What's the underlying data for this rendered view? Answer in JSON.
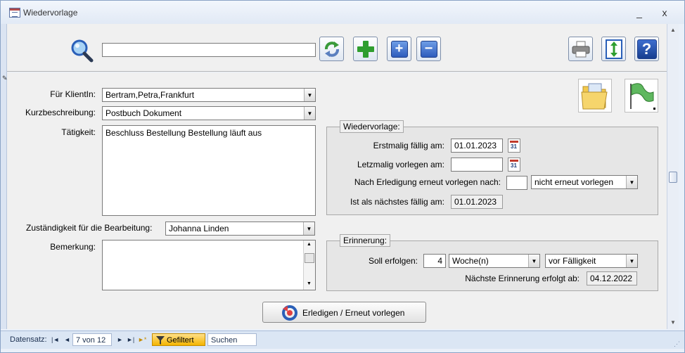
{
  "window": {
    "title": "Wiedervorlage",
    "minimize_glyph": "_",
    "close_glyph": "x"
  },
  "toolbar": {
    "search_value": "",
    "icons": [
      "search-icon",
      "refresh-icon",
      "add-icon",
      "expand-icon",
      "collapse-icon",
      "print-icon",
      "fit-height-icon",
      "help-icon"
    ],
    "expand_glyph": "+",
    "collapse_glyph": "−",
    "help_glyph": "?"
  },
  "form": {
    "klient_label": "Für KlientIn:",
    "klient_value": "Bertram,Petra,Frankfurt",
    "kurz_label": "Kurzbeschreibung:",
    "kurz_value": "Postbuch Dokument",
    "taetigkeit_label": "Tätigkeit:",
    "taetigkeit_value": "Beschluss Bestellung Bestellung läuft aus",
    "zustaendig_label": "Zuständigkeit für die Bearbeitung:",
    "zustaendig_value": "Johanna Linden",
    "bemerkung_label": "Bemerkung:",
    "bemerkung_value": ""
  },
  "wiedervorlage": {
    "legend": "Wiedervorlage:",
    "erstmalig_label": "Erstmalig fällig am:",
    "erstmalig_value": "01.01.2023",
    "letztmalig_label": "Letzmalig vorlegen am:",
    "letztmalig_value": "",
    "nach_label": "Nach Erledigung erneut vorlegen nach:",
    "nach_number": "",
    "nach_option": "nicht erneut vorlegen",
    "naechstes_label": "Ist als nächstes fällig am:",
    "naechstes_value": "01.01.2023",
    "calendar_day": "31"
  },
  "erinnerung": {
    "legend": "Erinnerung:",
    "soll_label": "Soll erfolgen:",
    "soll_number": "4",
    "soll_unit": "Woche(n)",
    "soll_relation": "vor Fälligkeit",
    "naechste_label": "Nächste Erinnerung erfolgt ab:",
    "naechste_value": "04.12.2022"
  },
  "actions": {
    "erledigen_label": "Erledigen / Erneut vorlegen"
  },
  "navbar": {
    "record_label": "Datensatz:",
    "record_value": "7 von 12",
    "first_glyph": "|◄",
    "prev_glyph": "◄",
    "next_glyph": "►",
    "last_glyph": "►|",
    "new_glyph": "►*",
    "filter_label": "Gefiltert",
    "search_label": "Suchen"
  },
  "colors": {
    "accent": "#2f9e2f",
    "window_border": "#8aa3c6",
    "filter_badge": "#f4b400"
  }
}
